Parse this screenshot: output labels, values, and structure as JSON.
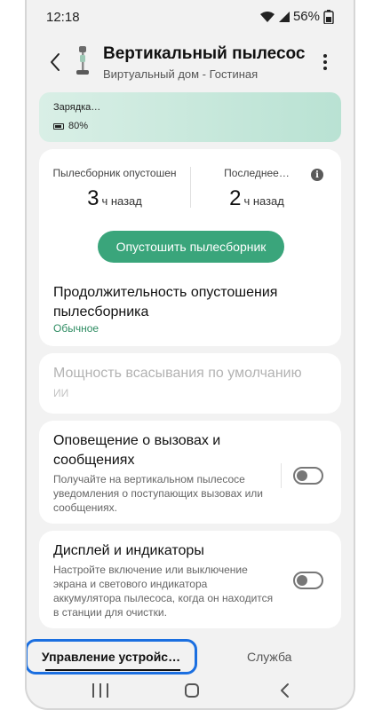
{
  "status_bar": {
    "time": "12:18",
    "battery_percent": "56%"
  },
  "header": {
    "title": "Вертикальный пылесос",
    "subtitle": "Виртуальный дом - Гостиная"
  },
  "banner": {
    "status": "Зарядка…",
    "battery": "80%",
    "gradient_start": "#d9efe6",
    "gradient_end": "#b9e2d3"
  },
  "bin": {
    "emptied_label": "Пылесборник опустошен",
    "emptied_number": "3",
    "emptied_unit": "ч назад",
    "last_label": "Последнее…",
    "last_number": "2",
    "last_unit": "ч назад",
    "info_glyph": "i",
    "empty_button": "Опустошить пылесборник",
    "duration_title": "Продолжительность опустошения пылесборника",
    "duration_value": "Обычное"
  },
  "suction": {
    "title": "Мощность всасывания по умолчанию",
    "value": "ИИ"
  },
  "calls": {
    "title": "Оповещение о вызовах и сообщениях",
    "description": "Получайте на вертикальном пылесосе уведомления о поступающих вызовах или сообщениях.",
    "enabled": false
  },
  "display": {
    "title": "Дисплей и индикаторы",
    "description": "Настройте включение или выключение экрана и светового индикатора аккумулятора пылесоса, когда он находится в станции для очистки.",
    "enabled": false
  },
  "tabs": {
    "device_control": "Управление устройс…",
    "service": "Служба"
  },
  "colors": {
    "accent_green": "#3aa57b",
    "highlight_blue": "#1b6fe0"
  },
  "icons": {
    "back": "chevron-left-icon",
    "more": "more-vertical-icon",
    "info": "info-icon",
    "battery": "battery-icon",
    "wifi": "wifi-icon"
  }
}
